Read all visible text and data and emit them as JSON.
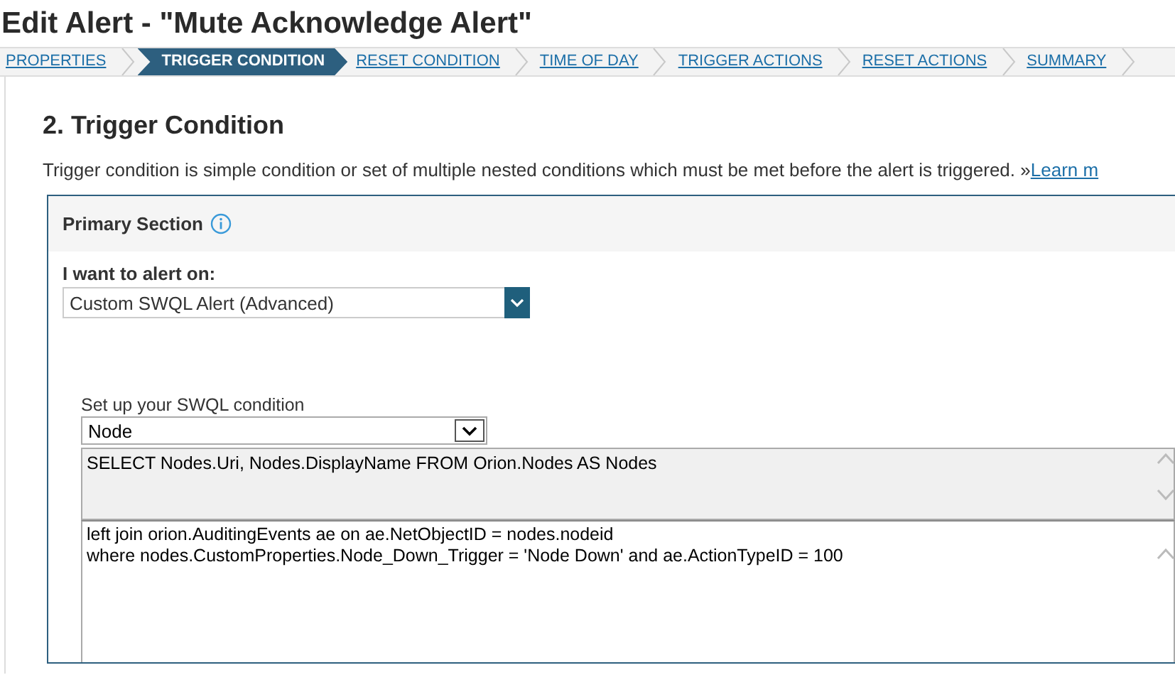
{
  "page_title": "Edit Alert - \"Mute Acknowledge Alert\"",
  "wizard_steps": [
    {
      "label": "PROPERTIES",
      "selected": false
    },
    {
      "label": "TRIGGER CONDITION",
      "selected": true
    },
    {
      "label": "RESET CONDITION",
      "selected": false
    },
    {
      "label": "TIME OF DAY",
      "selected": false
    },
    {
      "label": "TRIGGER ACTIONS",
      "selected": false
    },
    {
      "label": "RESET ACTIONS",
      "selected": false
    },
    {
      "label": "SUMMARY",
      "selected": false
    }
  ],
  "section_heading": "2. Trigger Condition",
  "description": "Trigger condition is simple condition or set of multiple nested conditions which must be met before the alert is triggered. »",
  "learn_more_link": "Learn m",
  "primary_section": {
    "title": "Primary Section",
    "alert_on_label": "I want to alert on:",
    "alert_on_value": "Custom SWQL Alert (Advanced)",
    "swql_label": "Set up your SWQL condition",
    "object_type_value": "Node",
    "select_statement": "SELECT Nodes.Uri, Nodes.DisplayName FROM Orion.Nodes AS Nodes",
    "condition_value": "left join orion.AuditingEvents ae on ae.NetObjectID = nodes.nodeid\nwhere nodes.CustomProperties.Node_Down_Trigger = 'Node Down' and ae.ActionTypeID = 100"
  }
}
